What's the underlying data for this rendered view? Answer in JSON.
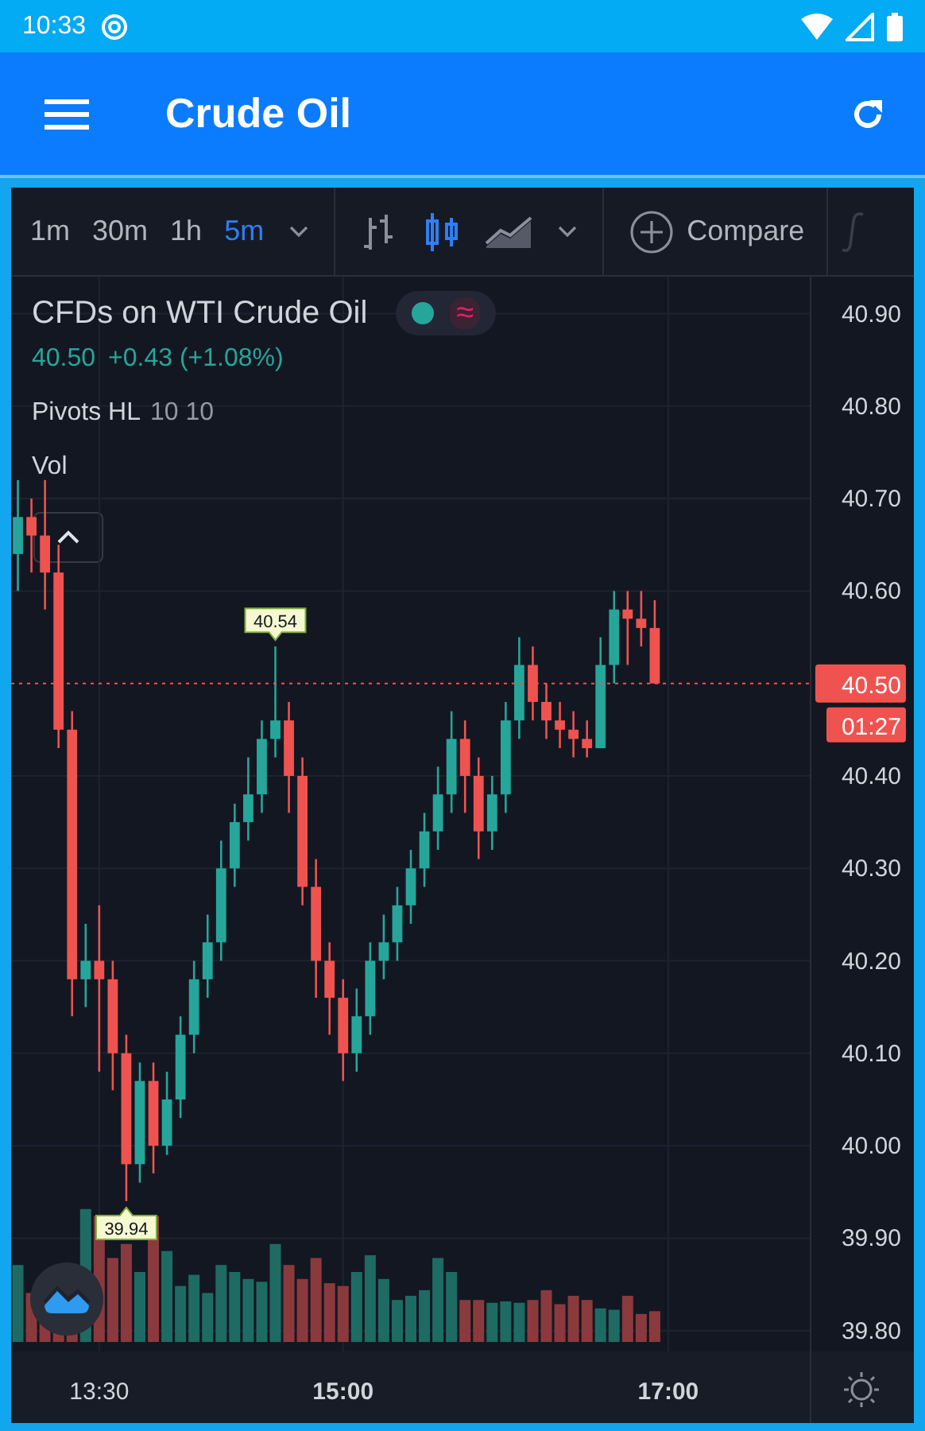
{
  "status_bar": {
    "time": "10:33"
  },
  "app_bar": {
    "title": "Crude Oil"
  },
  "toolbar": {
    "intervals": [
      {
        "label": "1m",
        "selected": false
      },
      {
        "label": "30m",
        "selected": false
      },
      {
        "label": "1h",
        "selected": false
      },
      {
        "label": "5m",
        "selected": true
      }
    ],
    "chart_types": [
      {
        "kind": "bars",
        "selected": false
      },
      {
        "kind": "candles",
        "selected": true
      },
      {
        "kind": "area",
        "selected": false
      }
    ],
    "compare": "Compare"
  },
  "legend": {
    "symbol": "CFDs on WTI Crude Oil",
    "delay_mark": "≈",
    "price": "40.50",
    "change": "+0.43 (+1.08%)",
    "indicators": [
      {
        "name": "Pivots HL",
        "params": "10 10"
      },
      {
        "name": "Vol"
      }
    ]
  },
  "chart_data": {
    "type": "candlestick",
    "grid": true,
    "categories": [
      null,
      null,
      null,
      null,
      null,
      null,
      "13:30",
      null,
      null,
      null,
      null,
      null,
      null,
      null,
      null,
      null,
      null,
      null,
      null,
      null,
      null,
      null,
      null,
      null,
      "15:00",
      null,
      null,
      null,
      null,
      null,
      null,
      null,
      null,
      null,
      null,
      null,
      null,
      null,
      null,
      null,
      null,
      null,
      null,
      null,
      null,
      null,
      null,
      null,
      "17:00",
      null,
      null,
      null,
      null,
      null,
      null,
      null,
      null,
      null,
      null
    ],
    "ylim": [
      39.7,
      40.94
    ],
    "yticks": [
      {
        "value": 40.9,
        "label": "40.90"
      },
      {
        "value": 40.8,
        "label": "40.80"
      },
      {
        "value": 40.7,
        "label": "40.70"
      },
      {
        "value": 40.6,
        "label": "40.60"
      },
      {
        "value": 40.4,
        "label": "40.40"
      },
      {
        "value": 40.3,
        "label": "40.30"
      },
      {
        "value": 40.2,
        "label": "40.20"
      },
      {
        "value": 40.1,
        "label": "40.10"
      },
      {
        "value": 40.0,
        "label": "40.00"
      },
      {
        "value": 39.9,
        "label": "39.90"
      },
      {
        "value": 39.8,
        "label": "39.80"
      }
    ],
    "ohlc": [
      [
        40.64,
        40.72,
        40.6,
        40.68
      ],
      [
        40.68,
        40.7,
        40.62,
        40.66
      ],
      [
        40.66,
        40.72,
        40.58,
        40.62
      ],
      [
        40.62,
        40.65,
        40.43,
        40.45
      ],
      [
        40.45,
        40.47,
        40.14,
        40.18
      ],
      [
        40.18,
        40.24,
        40.15,
        40.2
      ],
      [
        40.2,
        40.26,
        40.08,
        40.18
      ],
      [
        40.18,
        40.2,
        40.06,
        40.1
      ],
      [
        40.1,
        40.12,
        39.94,
        39.98
      ],
      [
        39.98,
        40.09,
        39.96,
        40.07
      ],
      [
        40.07,
        40.09,
        39.97,
        40.0
      ],
      [
        40.0,
        40.08,
        39.99,
        40.05
      ],
      [
        40.05,
        40.14,
        40.03,
        40.12
      ],
      [
        40.12,
        40.2,
        40.1,
        40.18
      ],
      [
        40.18,
        40.25,
        40.16,
        40.22
      ],
      [
        40.22,
        40.33,
        40.2,
        40.3
      ],
      [
        40.3,
        40.37,
        40.28,
        40.35
      ],
      [
        40.35,
        40.42,
        40.33,
        40.38
      ],
      [
        40.38,
        40.46,
        40.36,
        40.44
      ],
      [
        40.44,
        40.54,
        40.42,
        40.46
      ],
      [
        40.46,
        40.48,
        40.36,
        40.4
      ],
      [
        40.4,
        40.42,
        40.26,
        40.28
      ],
      [
        40.28,
        40.31,
        40.16,
        40.2
      ],
      [
        40.2,
        40.22,
        40.12,
        40.16
      ],
      [
        40.16,
        40.18,
        40.07,
        40.1
      ],
      [
        40.1,
        40.17,
        40.08,
        40.14
      ],
      [
        40.14,
        40.22,
        40.12,
        40.2
      ],
      [
        40.2,
        40.25,
        40.18,
        40.22
      ],
      [
        40.22,
        40.28,
        40.2,
        40.26
      ],
      [
        40.26,
        40.32,
        40.24,
        40.3
      ],
      [
        40.3,
        40.36,
        40.28,
        40.34
      ],
      [
        40.34,
        40.41,
        40.32,
        40.38
      ],
      [
        40.38,
        40.47,
        40.36,
        40.44
      ],
      [
        40.44,
        40.46,
        40.36,
        40.4
      ],
      [
        40.4,
        40.42,
        40.31,
        40.34
      ],
      [
        40.34,
        40.4,
        40.32,
        40.38
      ],
      [
        40.38,
        40.48,
        40.36,
        40.46
      ],
      [
        40.46,
        40.55,
        40.44,
        40.52
      ],
      [
        40.52,
        40.54,
        40.46,
        40.48
      ],
      [
        40.48,
        40.5,
        40.44,
        40.46
      ],
      [
        40.46,
        40.48,
        40.43,
        40.45
      ],
      [
        40.45,
        40.47,
        40.42,
        40.44
      ],
      [
        40.44,
        40.46,
        40.42,
        40.43
      ],
      [
        40.43,
        40.55,
        40.43,
        40.52
      ],
      [
        40.52,
        40.6,
        40.5,
        40.58
      ],
      [
        40.58,
        40.6,
        40.52,
        40.57
      ],
      [
        40.57,
        40.6,
        40.54,
        40.56
      ],
      [
        40.56,
        40.59,
        40.5,
        40.5
      ],
      null,
      null,
      null,
      null,
      null,
      null,
      null,
      null,
      null,
      null,
      null
    ],
    "ref_lines": [
      {
        "axis": "y",
        "value": 40.5,
        "label": "40.50"
      }
    ],
    "annotations": [
      {
        "y": 40.54,
        "text": "40.54"
      },
      {
        "y": 39.94,
        "text": "39.94"
      }
    ]
  },
  "last_price": {
    "countdown": "01:27"
  }
}
